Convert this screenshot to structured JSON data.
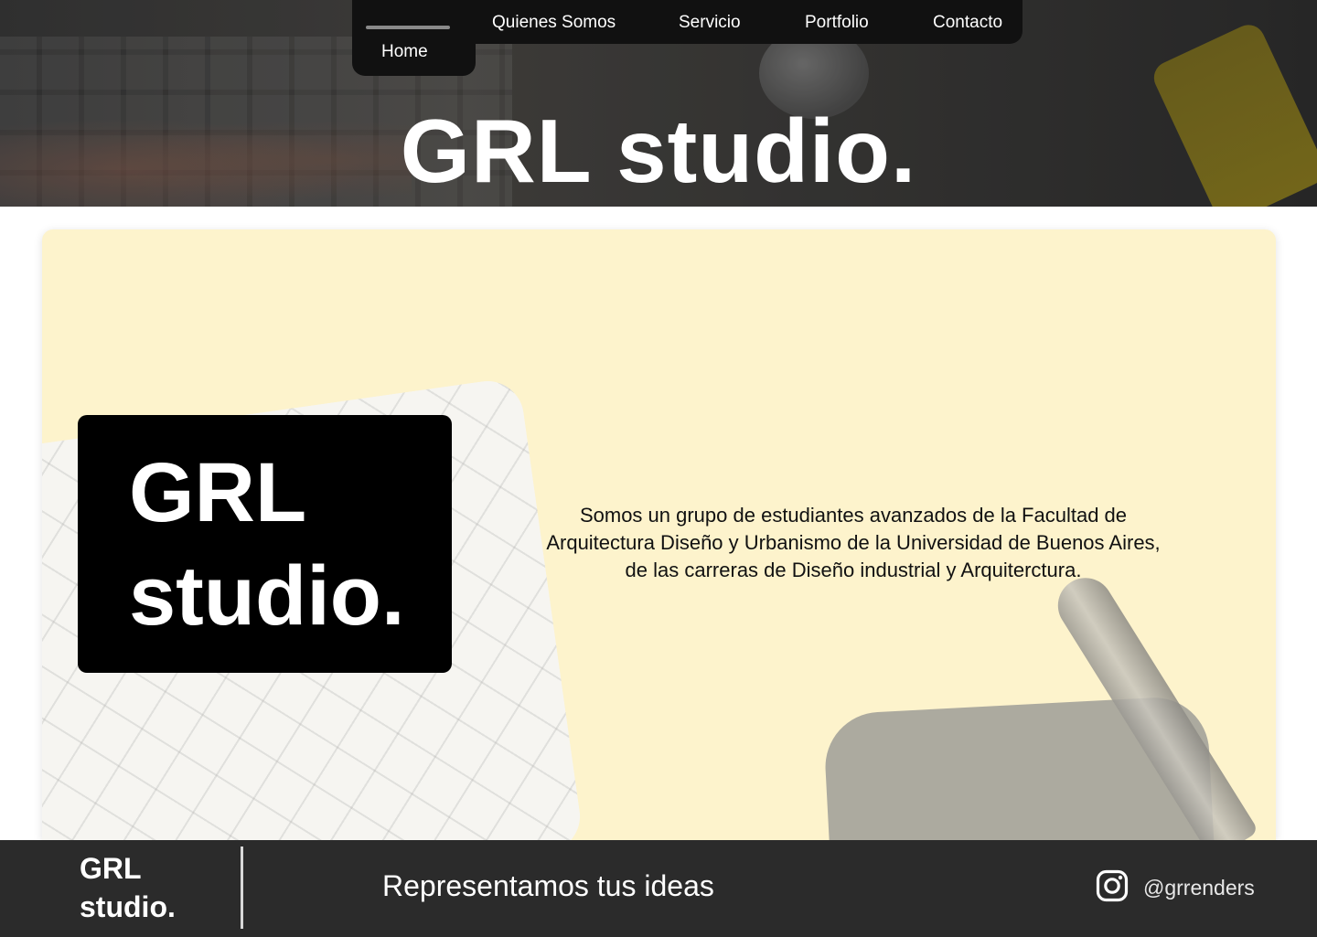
{
  "nav": {
    "items": [
      {
        "label": "Home"
      },
      {
        "label": "Quienes Somos"
      },
      {
        "label": "Servicio"
      },
      {
        "label": "Portfolio"
      },
      {
        "label": "Contacto"
      }
    ],
    "active": "Home"
  },
  "hero": {
    "title": "GRL studio."
  },
  "main": {
    "logo": {
      "line1": "GRL",
      "line2": "studio."
    },
    "description": {
      "lines": [
        "Somos un grupo de estudiantes avanzados  de la Facultad de",
        "Arquitectura Diseño y Urbanismo de la Universidad de Buenos Aires,",
        "de las carreras de Diseño industrial y Arquiterctura."
      ]
    },
    "background_color": "#fdf3cc"
  },
  "footer": {
    "logo_line1": "GRL",
    "logo_line2": "studio.",
    "tagline": "Representamos tus ideas",
    "social": {
      "icon": "instagram-icon",
      "handle": "@grrenders"
    },
    "background_color": "#2b2b2b"
  }
}
